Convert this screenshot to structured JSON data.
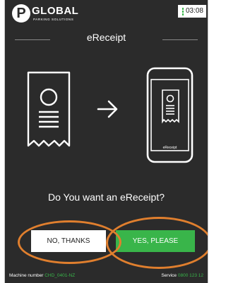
{
  "header": {
    "logo_letter": "P",
    "brand": "GLOBAL",
    "brand_sub": "PARKING SOLUTIONS",
    "time": "03:08"
  },
  "page": {
    "title": "eReceipt",
    "phone_label": "eReceipt",
    "question": "Do You want an eReceipt?"
  },
  "buttons": {
    "no_label": "NO, THANKS",
    "yes_label": "YES, PLEASE"
  },
  "footer": {
    "machine_label": "Machine number",
    "machine_value": "CHD_0401-NZ",
    "service_label": "Service",
    "service_value": "0800 123 12"
  },
  "colors": {
    "background": "#2b2b2b",
    "accent_green": "#39b54a",
    "highlight_orange": "#e07f2e"
  },
  "icons": [
    "receipt-icon",
    "arrow-right-icon",
    "phone-receipt-icon",
    "signal-icon"
  ]
}
